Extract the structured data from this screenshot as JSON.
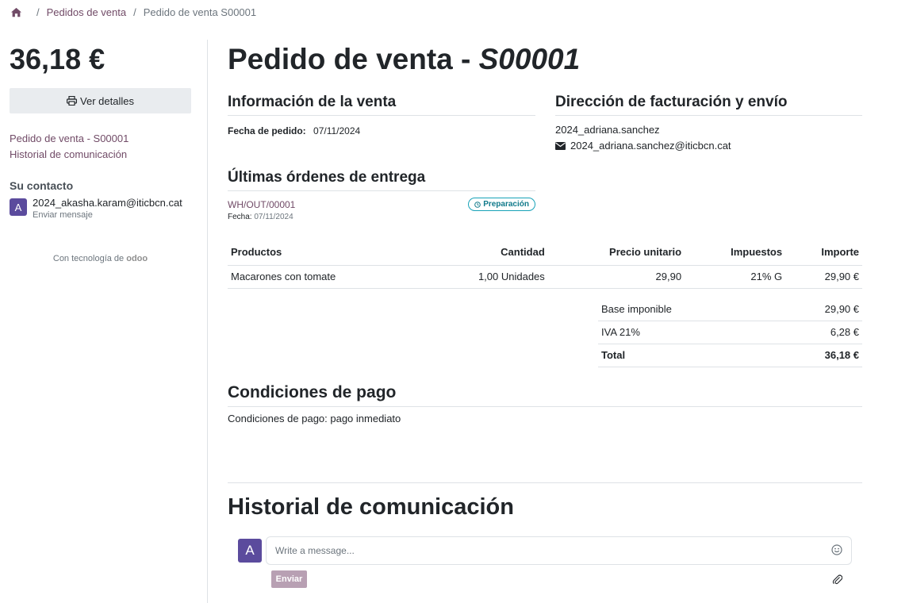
{
  "breadcrumb": {
    "icon": "home-icon",
    "items": [
      "Pedidos de venta",
      "Pedido de venta S00001"
    ]
  },
  "sidebar": {
    "total": "36,18 €",
    "view_details": "Ver detalles",
    "links": [
      "Pedido de venta - S00001",
      "Historial de comunicación"
    ],
    "contact_title": "Su contacto",
    "contact_initial": "A",
    "contact_email": "2024_akasha.karam@iticbcn.cat",
    "contact_action": "Enviar mensaje",
    "powered_by": "Con tecnología de",
    "powered_brand": "odoo"
  },
  "main": {
    "title_prefix": "Pedido de venta - ",
    "title_ref": "S00001",
    "sale_info": {
      "heading": "Información de la venta",
      "date_label": "Fecha de pedido:",
      "date_value": "07/11/2024"
    },
    "address": {
      "heading": "Dirección de facturación y envío",
      "name": "2024_adriana.sanchez",
      "email": "2024_adriana.sanchez@iticbcn.cat"
    },
    "deliveries": {
      "heading": "Últimas órdenes de entrega",
      "ref": "WH/OUT/00001",
      "status": "Preparación",
      "date_label": "Fecha:",
      "date_value": "07/11/2024"
    },
    "lines": {
      "headers": [
        "Productos",
        "Cantidad",
        "Precio unitario",
        "Impuestos",
        "Importe"
      ],
      "rows": [
        [
          "Macarones con tomate",
          "1,00 Unidades",
          "29,90",
          "21% G",
          "29,90 €"
        ]
      ]
    },
    "totals": {
      "base_label": "Base imponible",
      "base_value": "29,90 €",
      "tax_label": "IVA 21%",
      "tax_value": "6,28 €",
      "total_label": "Total",
      "total_value": "36,18 €"
    },
    "payment": {
      "heading": "Condiciones de pago",
      "text": "Condiciones de pago: pago inmediato"
    },
    "history": {
      "heading": "Historial de comunicación",
      "avatar_initial": "A",
      "placeholder": "Write a message...",
      "send_label": "Enviar"
    }
  },
  "colors": {
    "brand": "#714B67",
    "avatar": "#5b4b9d",
    "badge": "#17a2b8",
    "send_disabled": "#b8a0b3"
  }
}
